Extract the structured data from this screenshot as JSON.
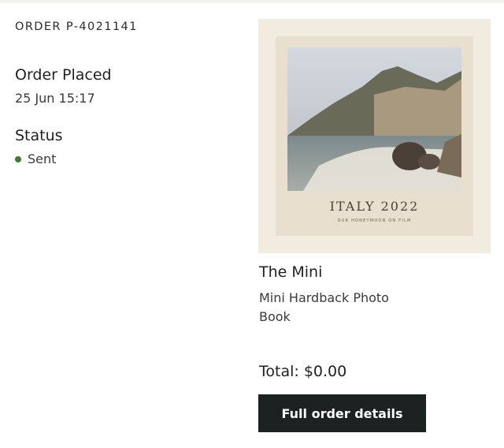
{
  "order": {
    "id_label": "ORDER P-4021141",
    "placed_label": "Order Placed",
    "placed_value": "25 Jun 15:17",
    "status_label": "Status",
    "status_value": "Sent",
    "status_color": "#3f7b2e"
  },
  "product": {
    "cover_title": "ITALY 2022",
    "cover_subtitle": "OUR HONEYMOON ON FILM",
    "name": "The Mini",
    "description": "Mini Hardback Photo Book",
    "total": "Total: $0.00"
  },
  "actions": {
    "details_label": "Full order details"
  },
  "colors": {
    "button_bg": "#1c2222",
    "thumb_bg": "#f1ebe0",
    "cover_bg": "#e9dfcf"
  }
}
